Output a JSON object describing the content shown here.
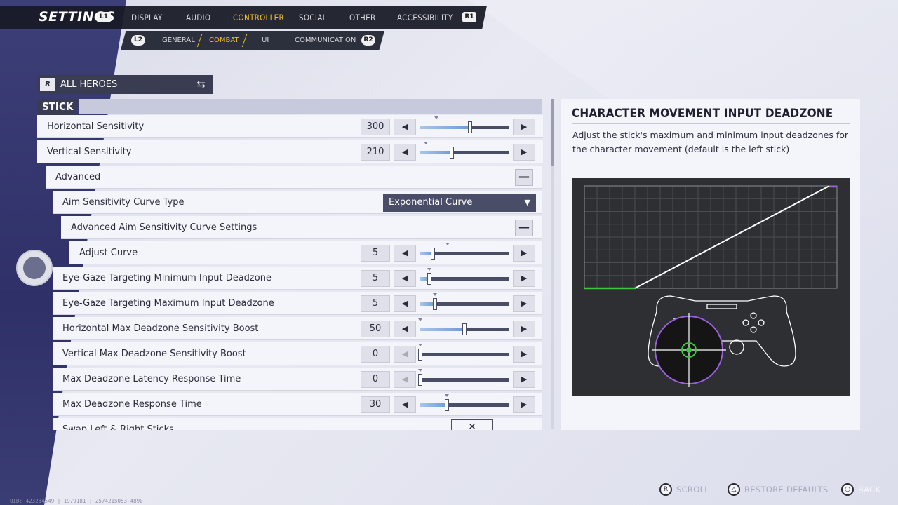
{
  "header": {
    "title": "SETTINGS",
    "left_bumper": "L1",
    "right_bumper": "R1",
    "tabs": [
      {
        "label": "DISPLAY",
        "active": false
      },
      {
        "label": "AUDIO",
        "active": false
      },
      {
        "label": "CONTROLLER",
        "active": true
      },
      {
        "label": "SOCIAL",
        "active": false
      },
      {
        "label": "OTHER",
        "active": false
      },
      {
        "label": "ACCESSIBILITY",
        "active": false
      }
    ]
  },
  "subnav": {
    "left_trigger": "L2",
    "right_trigger": "R2",
    "tabs": [
      {
        "label": "GENERAL",
        "active": false
      },
      {
        "label": "COMBAT",
        "active": true
      },
      {
        "label": "UI",
        "active": false
      },
      {
        "label": "COMMUNICATION",
        "active": false
      }
    ]
  },
  "hero_selector": {
    "logo": "R",
    "label": "ALL HEROES",
    "icon": "swap-arrows-icon"
  },
  "section": {
    "label": "STICK"
  },
  "settings": [
    {
      "label": "Horizontal Sensitivity",
      "value": "300",
      "fill": 0.56,
      "default": 0.18,
      "indent": 0,
      "type": "slider"
    },
    {
      "label": "Vertical Sensitivity",
      "value": "210",
      "fill": 0.36,
      "default": 0.06,
      "indent": 0,
      "type": "slider"
    },
    {
      "label": "Advanced",
      "indent": 1,
      "type": "group",
      "collapse_symbol": "—"
    },
    {
      "label": "Aim Sensitivity Curve Type",
      "indent": 2,
      "type": "dropdown",
      "value": "Exponential Curve"
    },
    {
      "label": "Advanced Aim Sensitivity Curve Settings",
      "indent": 3,
      "type": "group",
      "collapse_symbol": "—"
    },
    {
      "label": "Adjust Curve",
      "value": "5",
      "fill": 0.14,
      "default": 0.31,
      "indent": 4,
      "type": "slider"
    },
    {
      "label": "Eye-Gaze Targeting Minimum Input Deadzone",
      "value": "5",
      "fill": 0.1,
      "default": 0.1,
      "indent": 2,
      "type": "slider"
    },
    {
      "label": "Eye-Gaze Targeting Maximum Input Deadzone",
      "value": "5",
      "fill": 0.17,
      "default": 0.17,
      "indent": 2,
      "type": "slider"
    },
    {
      "label": "Horizontal Max Deadzone Sensitivity Boost",
      "value": "50",
      "fill": 0.5,
      "default": 0.0,
      "indent": 2,
      "type": "slider"
    },
    {
      "label": "Vertical Max Deadzone Sensitivity Boost",
      "value": "0",
      "fill": 0.0,
      "default": 0.0,
      "indent": 2,
      "type": "slider",
      "left_disabled": true
    },
    {
      "label": "Max Deadzone Latency Response Time",
      "value": "0",
      "fill": 0.0,
      "default": 0.0,
      "indent": 2,
      "type": "slider",
      "left_disabled": true
    },
    {
      "label": "Max Deadzone Response Time",
      "value": "30",
      "fill": 0.3,
      "default": 0.3,
      "indent": 2,
      "type": "slider"
    },
    {
      "label": "Swap Left & Right Sticks",
      "indent": 2,
      "type": "toggle",
      "value": "✕"
    }
  ],
  "detail": {
    "title": "CHARACTER MOVEMENT INPUT DEADZONE",
    "description": "Adjust the stick's maximum and minimum input deadzones for the character movement (default is the left stick)",
    "graph": {
      "min_deadzone": 0.2,
      "max_deadzone": 0.97,
      "line_color": "#ffffff",
      "min_color": "#3ec83e",
      "max_color": "#9b5fe0"
    }
  },
  "footer": {
    "hints": [
      {
        "button": "R",
        "label": "SCROLL",
        "dim": true
      },
      {
        "button": "△",
        "label": "RESTORE DEFAULTS",
        "dim": true
      },
      {
        "button": "○",
        "label": "BACK",
        "dim": false
      }
    ],
    "uid": "UID: 423234549 | 1979181 | 2574215053-4890"
  },
  "colors": {
    "accent": "#f2c31f",
    "panel": "#f4f5fa",
    "dark": "#3a3d52"
  }
}
